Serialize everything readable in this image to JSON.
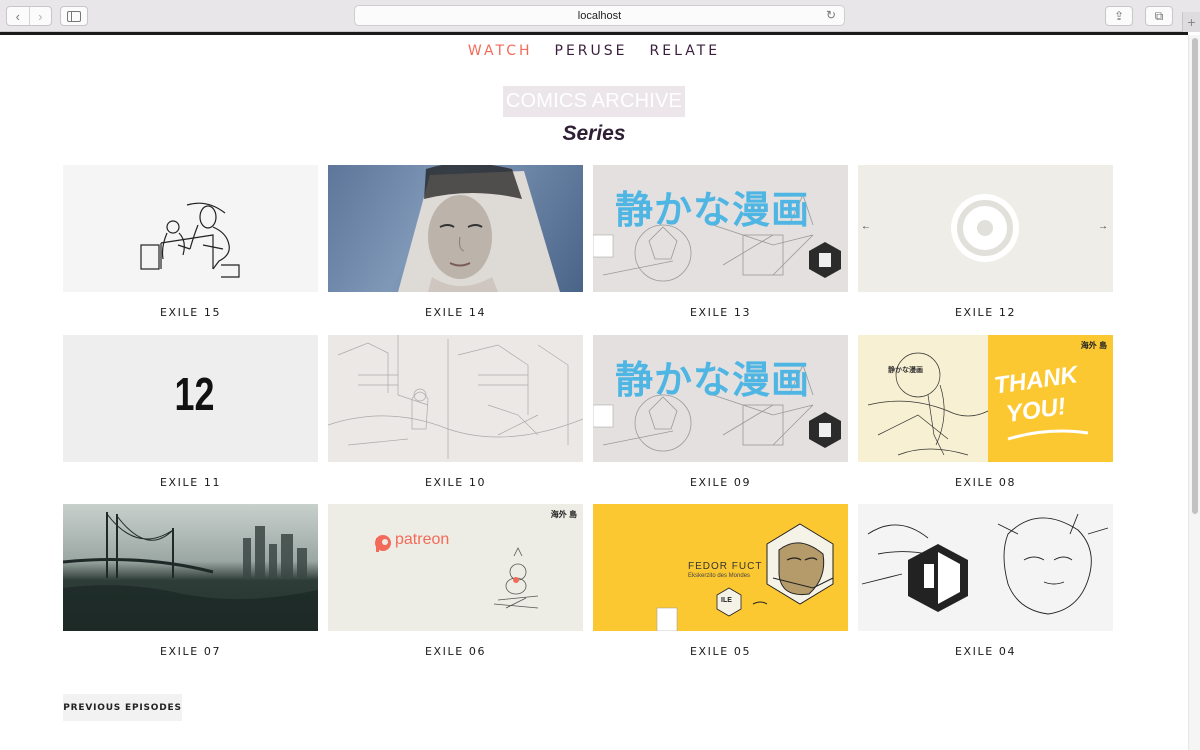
{
  "browser": {
    "url": "localhost",
    "back_glyph": "‹",
    "forward_glyph": "›",
    "reload_glyph": "↻",
    "share_glyph": "⇪",
    "tabs_glyph": "⧉",
    "new_tab_glyph": "+"
  },
  "nav": {
    "watch": "WATCH",
    "peruse": "PERUSE",
    "relate": "RELATE"
  },
  "header": {
    "archive": "COMICS ARCHIVE",
    "series": "Series"
  },
  "colors": {
    "accent": "#f26b5a",
    "nav_text": "#3a1f3d",
    "yellow": "#fcc832",
    "cyan": "#52b9e8"
  },
  "episodes": [
    {
      "title": "EXILE 15"
    },
    {
      "title": "EXILE 14"
    },
    {
      "title": "EXILE 13",
      "jp_text": "静かな漫画"
    },
    {
      "title": "EXILE 12"
    },
    {
      "title": "EXILE 11",
      "number": "12"
    },
    {
      "title": "EXILE 10"
    },
    {
      "title": "EXILE 09",
      "jp_text": "静かな漫画"
    },
    {
      "title": "EXILE 08",
      "thank": "THANK",
      "you": "YOU!",
      "corner_mark": "海外 島",
      "small_jp": "静かな漫画"
    },
    {
      "title": "EXILE 07"
    },
    {
      "title": "EXILE 06",
      "patreon": "patreon",
      "corner_mark": "海外 島"
    },
    {
      "title": "EXILE 05",
      "author": "FEDOR FUCT",
      "subtitle": "Ekskerzito des Mondes",
      "badge": "ILE"
    },
    {
      "title": "EXILE 04"
    }
  ],
  "pager": {
    "prev_label": "PREVIOUS EPISODES"
  }
}
